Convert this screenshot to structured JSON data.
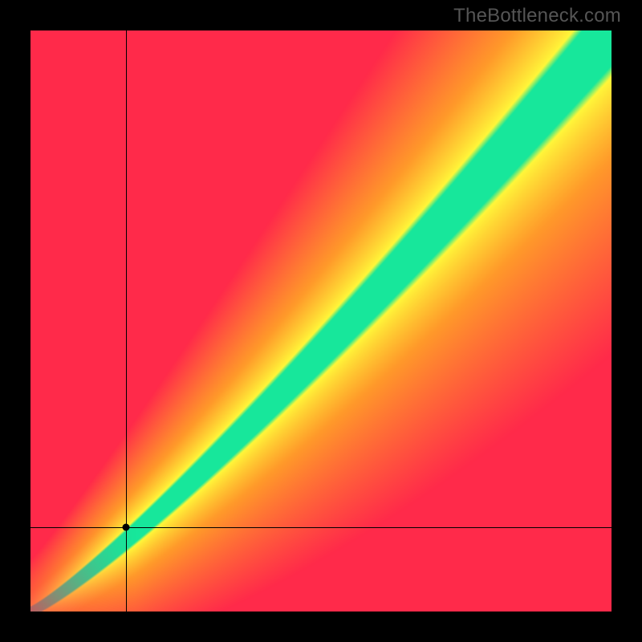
{
  "watermark": "TheBottleneck.com",
  "chart_data": {
    "type": "heatmap",
    "title": "",
    "xlabel": "",
    "ylabel": "",
    "xlim": [
      0,
      1
    ],
    "ylim": [
      0,
      1
    ],
    "grid": false,
    "legend": false,
    "description": "Bottleneck match heatmap. Green diagonal band = matched CPU/GPU; red = heavy bottleneck; yellow/orange = partial mismatch.",
    "color_scale": {
      "match": "#17e79b",
      "near": "#fff83a",
      "mid": "#ff9a2a",
      "far": "#ff2a4a"
    },
    "band": {
      "spine_start": [
        0.02,
        0.02
      ],
      "spine_end": [
        1.0,
        0.98
      ],
      "width_start": 0.02,
      "width_end": 0.16,
      "curve_exponent": 1.18
    },
    "marker": {
      "x": 0.165,
      "y": 0.145
    },
    "crosshair": {
      "x": 0.165,
      "y": 0.145
    }
  }
}
